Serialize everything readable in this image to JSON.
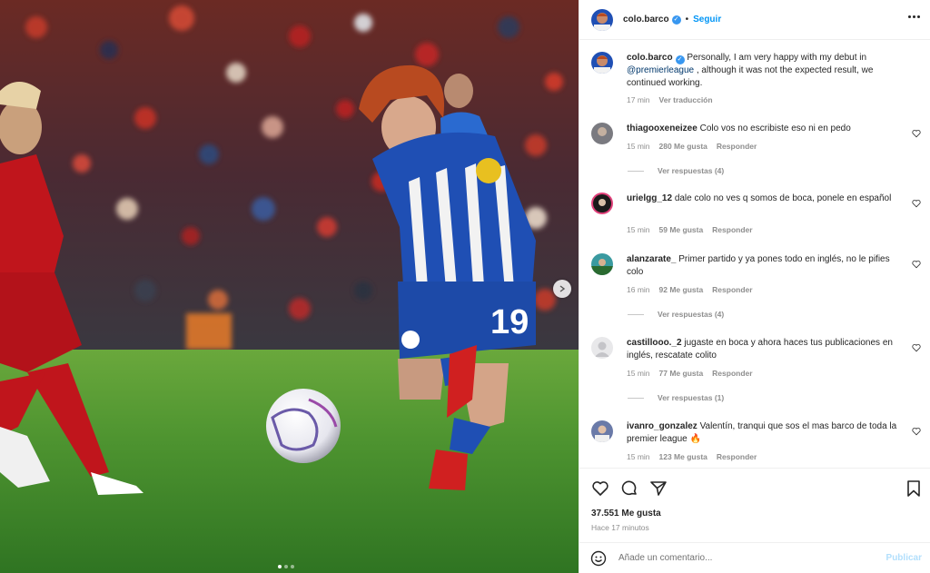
{
  "post": {
    "username": "colo.barco",
    "follow_label": "Seguir",
    "separator": "•",
    "verified_mark": "✓",
    "caption_text": "Personally, I am very happy with my debut in",
    "caption_mention": "@premierleague",
    "caption_rest": ", although it was not the expected result, we continued working.",
    "caption_time": "17 min",
    "translate_label": "Ver traducción"
  },
  "comments": [
    {
      "user": "thiagooxeneizee",
      "text": "Colo vos no escribiste eso ni en pedo",
      "time": "15 min",
      "likes": "280 Me gusta",
      "reply": "Responder",
      "view_replies": "Ver respuestas (4)"
    },
    {
      "user": "urielgg_12",
      "text": "dale colo no ves q somos de boca, ponele en español",
      "time": "15 min",
      "likes": "59 Me gusta",
      "reply": "Responder",
      "view_replies": ""
    },
    {
      "user": "alanzarate_",
      "text": "Primer partido y ya pones todo en inglés, no le pifies colo",
      "time": "16 min",
      "likes": "92 Me gusta",
      "reply": "Responder",
      "view_replies": "Ver respuestas (4)"
    },
    {
      "user": "castillooo._2",
      "text": "jugaste en boca y ahora haces tus publicaciones en inglés, rescatate colito",
      "time": "15 min",
      "likes": "77 Me gusta",
      "reply": "Responder",
      "view_replies": "Ver respuestas (1)"
    },
    {
      "user": "ivanro_gonzalez",
      "text": "Valentín, tranqui que sos el mas barco de toda la premier league 🔥",
      "time": "15 min",
      "likes": "123 Me gusta",
      "reply": "Responder",
      "view_replies": ""
    }
  ],
  "stats": {
    "likes": "37.551 Me gusta",
    "posted": "Hace 17 minutos"
  },
  "composer": {
    "placeholder": "Añade un comentario...",
    "publish_label": "Publicar"
  },
  "icons": {
    "more": "more-options-icon",
    "like": "heart-icon",
    "comment": "comment-icon",
    "share": "share-icon",
    "save": "bookmark-icon",
    "emoji": "emoji-icon",
    "next": "chevron-right-icon"
  },
  "colors": {
    "link": "#0095f6",
    "verified": "#3897f0",
    "mention": "#00376b",
    "muted": "#8e8e8e",
    "brighton_blue": "#1f4fb4",
    "liverpool_red": "#c0151c",
    "pitch_green": "#3f8a2a"
  }
}
